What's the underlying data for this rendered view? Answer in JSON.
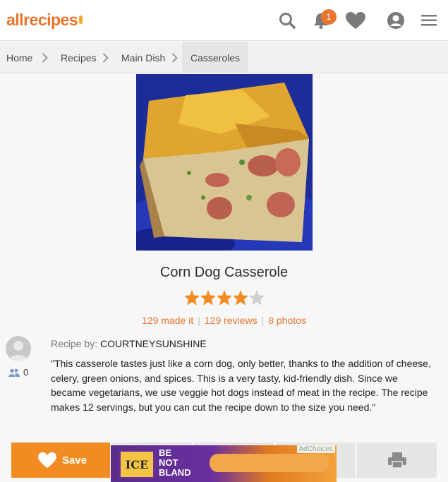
{
  "header": {
    "logo": "allrecipes",
    "notification_count": "1"
  },
  "breadcrumb": [
    "Home",
    "Recipes",
    "Main Dish",
    "Casseroles"
  ],
  "recipe": {
    "title": "Corn Dog Casserole",
    "rating": 4,
    "rating_max": 5,
    "made_it": "129 made it",
    "reviews": "129 reviews",
    "photos": "8 photos",
    "byline_label": "Recipe by:",
    "author": "COURTNEYSUNSHINE",
    "followers": "0",
    "description": "\"This casserole tastes just like a corn dog, only better, thanks to the addition of cheese, celery, green onions, and spices. This is a very tasty, kid-friendly dish. Since we became vegetarians, we use veggie hot dogs instead of meat in the recipe. The recipe makes 12 servings, but you can cut the recipe down to the size you need.\""
  },
  "actions": {
    "save_label": "Save"
  },
  "ad": {
    "brand": "ICE",
    "slogan": [
      "BE",
      "NOT",
      "BLAND"
    ],
    "adchoices": "AdChoices"
  },
  "colors": {
    "accent": "#e8742e",
    "save_button": "#f28c22",
    "star_filled": "#f28c22",
    "star_empty": "#d0d0d0"
  },
  "icons": [
    "search-icon",
    "bell-icon",
    "heart-icon",
    "user-icon",
    "menu-icon",
    "chevron-right-icon",
    "followers-icon",
    "print-icon"
  ]
}
